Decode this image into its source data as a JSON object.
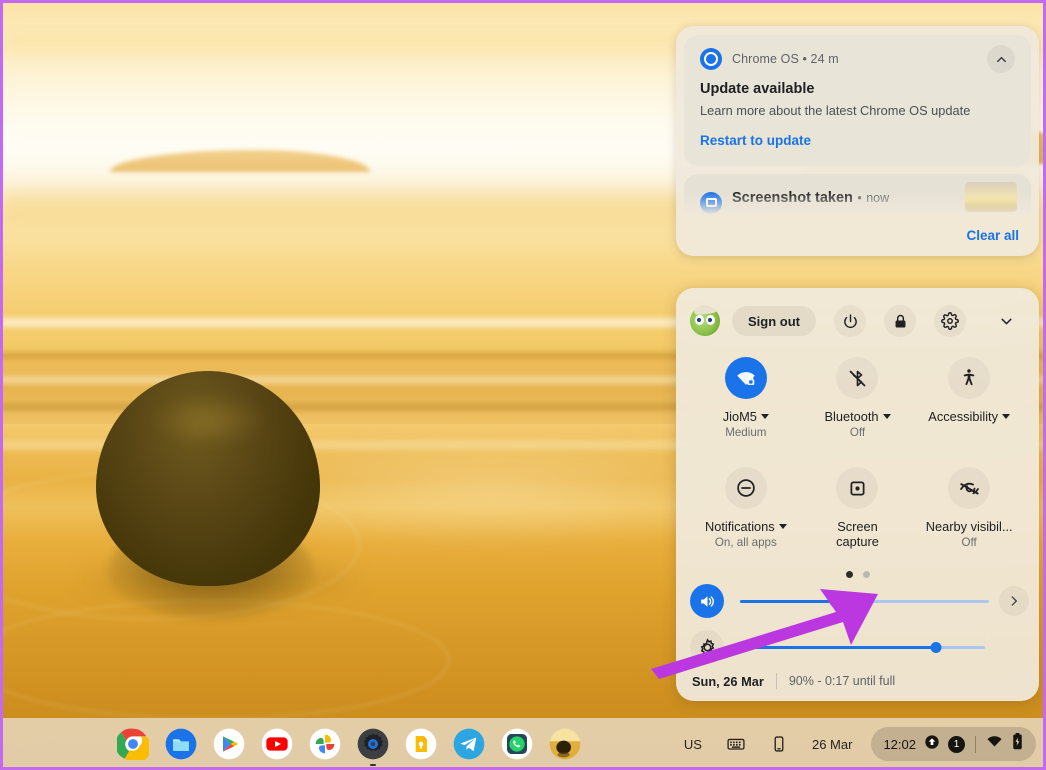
{
  "wallpaper": {
    "description": "Moeraki boulder on golden sunset beach"
  },
  "notifications": {
    "items": [
      {
        "app": "Chrome OS",
        "separator": "•",
        "time": "24 m",
        "title": "Update available",
        "body": "Learn more about the latest Chrome OS update",
        "action": "Restart to update",
        "app_icon": "chrome-os-update-icon",
        "collapse_icon": "chevron-up-icon"
      },
      {
        "app": "",
        "separator": "•",
        "time": "now",
        "title": "Screenshot taken",
        "app_icon": "screenshot-icon"
      }
    ],
    "clear_all_label": "Clear all"
  },
  "quick_settings": {
    "avatar_name": "user-avatar",
    "sign_out_label": "Sign out",
    "top_icons": [
      {
        "name": "power-icon"
      },
      {
        "name": "lock-icon"
      },
      {
        "name": "gear-icon"
      },
      {
        "name": "chevron-down-icon"
      }
    ],
    "tiles": [
      {
        "icon": "wifi-locked-icon",
        "label": "JioM5",
        "sub": "Medium",
        "has_caret": true,
        "active": true,
        "two_line": false
      },
      {
        "icon": "bluetooth-off-icon",
        "label": "Bluetooth",
        "sub": "Off",
        "has_caret": true,
        "active": false,
        "two_line": false
      },
      {
        "icon": "accessibility-icon",
        "label": "Accessibility",
        "sub": "",
        "has_caret": true,
        "active": false,
        "two_line": false
      },
      {
        "icon": "do-not-disturb-icon",
        "label": "Notifications",
        "sub": "On, all apps",
        "has_caret": true,
        "active": false,
        "two_line": false
      },
      {
        "icon": "screen-capture-icon",
        "label": "Screen",
        "label2": "capture",
        "sub": "",
        "has_caret": false,
        "active": false,
        "two_line": true
      },
      {
        "icon": "nearby-visibility-off-icon",
        "label": "Nearby visibil...",
        "sub": "Off",
        "has_caret": false,
        "active": false,
        "two_line": false
      }
    ],
    "page_dots": {
      "count": 2,
      "active_index": 0
    },
    "sliders": [
      {
        "name": "volume",
        "icon": "volume-on-icon",
        "value": 38,
        "icon_active": true,
        "has_next": true
      },
      {
        "name": "brightness",
        "icon": "brightness-icon",
        "value": 80,
        "icon_active": false,
        "has_next": false
      }
    ],
    "footer": {
      "date": "Sun, 26 Mar",
      "battery": "90% - 0:17 until full"
    }
  },
  "shelf": {
    "apps": [
      {
        "name": "chrome",
        "icon": "chrome-icon"
      },
      {
        "name": "files",
        "icon": "files-icon"
      },
      {
        "name": "play-store",
        "icon": "play-store-icon"
      },
      {
        "name": "youtube",
        "icon": "youtube-icon"
      },
      {
        "name": "google-photos",
        "icon": "google-photos-icon"
      },
      {
        "name": "settings",
        "icon": "settings-gear-icon",
        "running": true
      },
      {
        "name": "keep",
        "icon": "keep-notes-icon"
      },
      {
        "name": "telegram",
        "icon": "telegram-icon"
      },
      {
        "name": "whatsapp",
        "icon": "whatsapp-icon"
      },
      {
        "name": "wallpaper-app",
        "icon": "wallpaper-thumbnail-icon"
      }
    ],
    "status": {
      "keyboard_layout": "US",
      "keyboard_icon": "keyboard-icon",
      "phone_hub_icon": "phone-icon",
      "date": "26 Mar",
      "time": "12:02",
      "update_icon": "update-available-icon",
      "notification_count": "1",
      "network_icon": "wifi-icon",
      "battery_icon": "battery-charging-icon"
    }
  },
  "annotation": {
    "arrow_color": "#bb38e0",
    "target": "page-dots"
  },
  "colors": {
    "accent_blue": "#1a73e8",
    "panel_bg": "#f0eadc",
    "text_primary": "#202124",
    "text_secondary": "#5f6368",
    "border_purple": "#c46af0"
  }
}
